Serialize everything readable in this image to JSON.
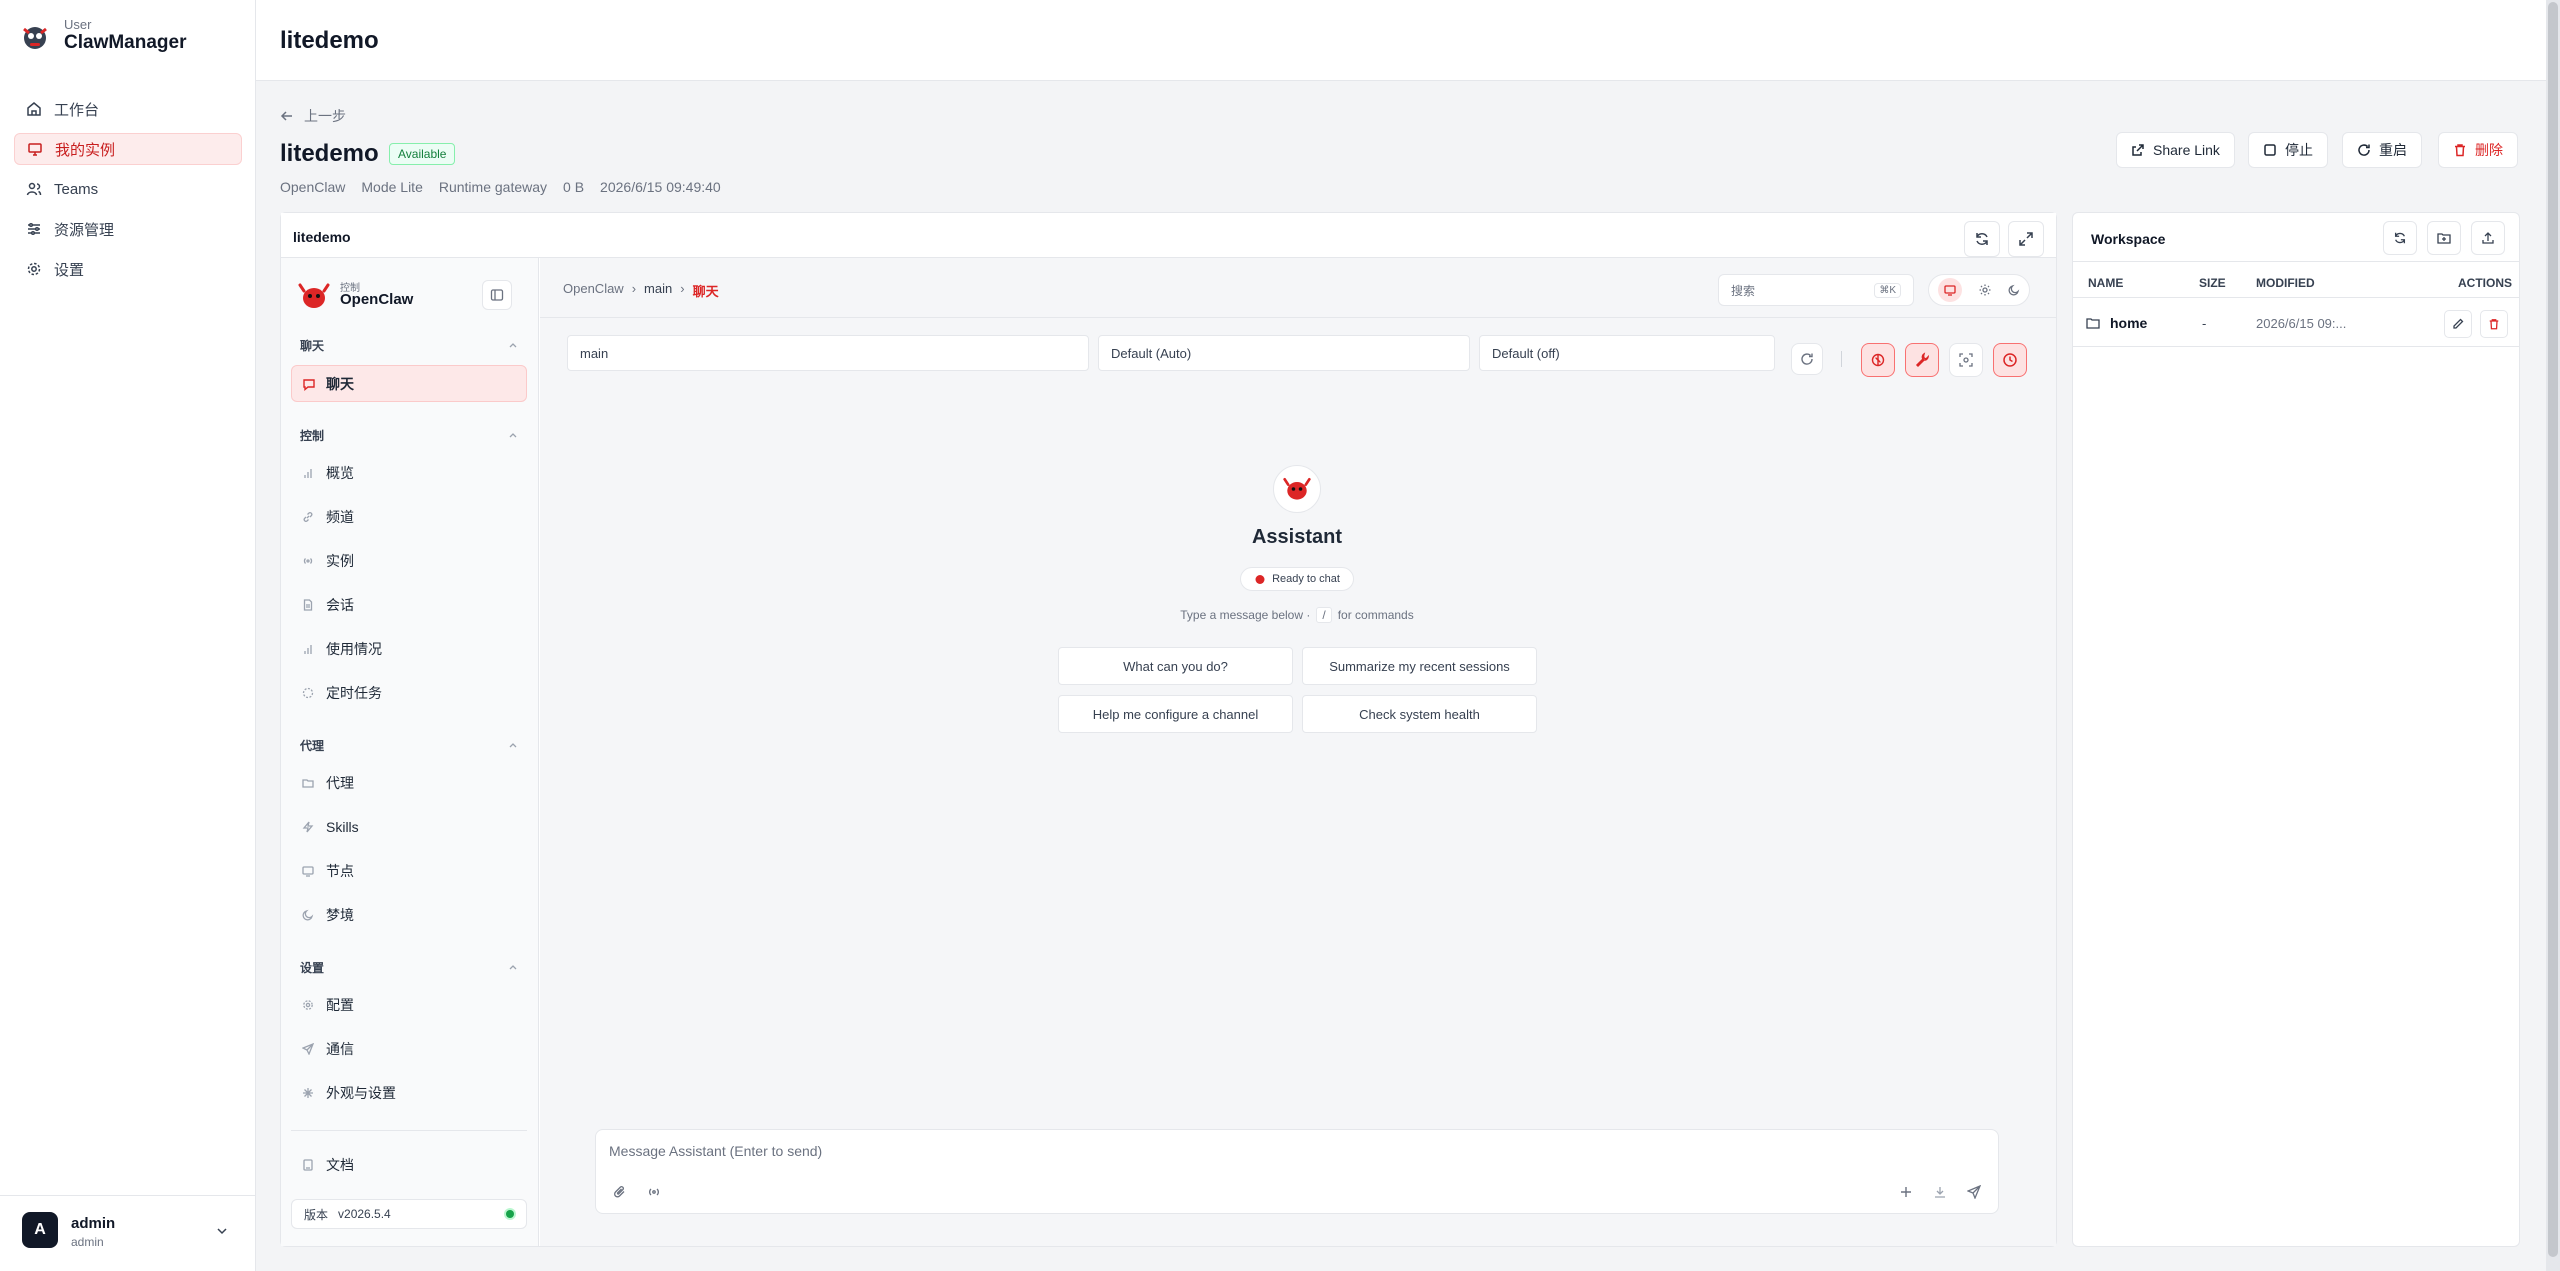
{
  "brand": {
    "sub": "User",
    "name": "ClawManager"
  },
  "nav": {
    "items": [
      {
        "label": "工作台",
        "icon": "home-icon"
      },
      {
        "label": "我的实例",
        "icon": "monitor-icon"
      },
      {
        "label": "Teams",
        "icon": "users-icon"
      },
      {
        "label": "资源管理",
        "icon": "sliders-icon"
      },
      {
        "label": "设置",
        "icon": "gear-icon"
      }
    ]
  },
  "user": {
    "name": "admin",
    "role": "admin",
    "initial": "A"
  },
  "header": {
    "title": "litedemo"
  },
  "instance": {
    "back_label": "上一步",
    "name": "litedemo",
    "status": "Available",
    "meta": [
      "OpenClaw",
      "Mode Lite",
      "Runtime gateway",
      "0 B",
      "2026/6/15 09:49:40"
    ],
    "actions": {
      "share": "Share Link",
      "stop": "停止",
      "restart": "重启",
      "delete": "删除"
    }
  },
  "embed": {
    "title": "litedemo"
  },
  "openclaw": {
    "brand_sub": "控制",
    "brand_name": "OpenClaw",
    "sections": {
      "chat": "聊天",
      "control": "控制",
      "agent": "代理",
      "settings": "设置"
    },
    "chat_item": "聊天",
    "control_items": [
      "概览",
      "频道",
      "实例",
      "会话",
      "使用情况",
      "定时任务"
    ],
    "agent_items": [
      "代理",
      "Skills",
      "节点",
      "梦境"
    ],
    "settings_items": [
      "配置",
      "通信",
      "外观与设置"
    ],
    "docs": "文档",
    "version_label": "版本",
    "version": "v2026.5.4"
  },
  "chat": {
    "breadcrumb": [
      "OpenClaw",
      "main",
      "聊天"
    ],
    "search_placeholder": "搜索",
    "search_shortcut": "⌘K",
    "selects": {
      "session": "main",
      "model": "Default (Auto)",
      "thinking": "Default (off)"
    },
    "assistant_name": "Assistant",
    "status": "Ready to chat",
    "hint_before": "Type a message below ·",
    "hint_key": "/",
    "hint_after": "for commands",
    "suggestions": [
      "What can you do?",
      "Summarize my recent sessions",
      "Help me configure a channel",
      "Check system health"
    ],
    "input_placeholder": "Message Assistant (Enter to send)"
  },
  "workspace": {
    "title": "Workspace",
    "columns": {
      "name": "NAME",
      "size": "SIZE",
      "modified": "MODIFIED",
      "actions": "ACTIONS"
    },
    "rows": [
      {
        "name": "home",
        "size": "-",
        "modified": "2026/6/15 09:..."
      }
    ]
  },
  "colors": {
    "accent": "#dc2626",
    "available": "#16a34a",
    "online": "#16a34a"
  }
}
